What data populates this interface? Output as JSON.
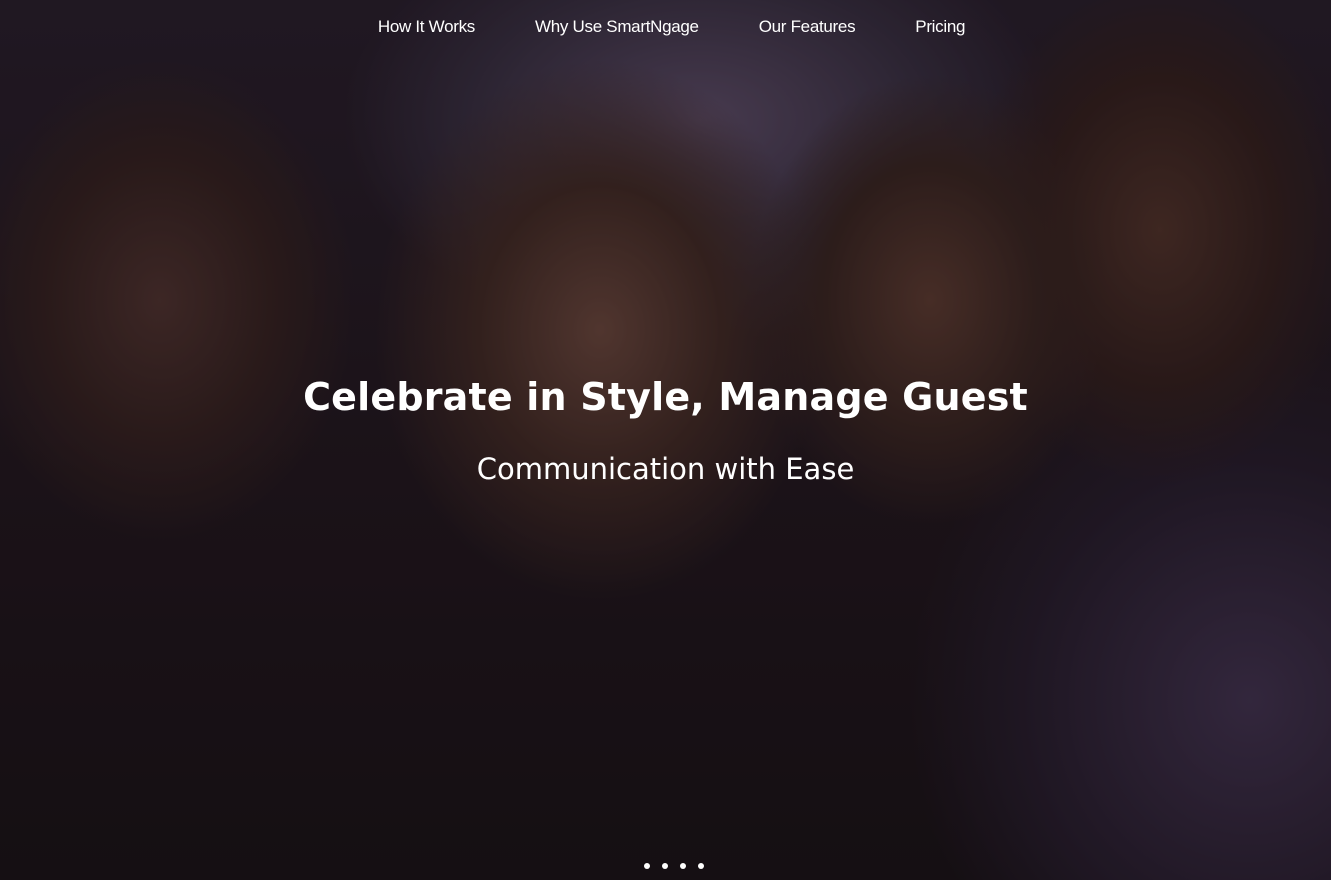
{
  "nav": {
    "items": [
      {
        "label": "How It Works"
      },
      {
        "label": "Why Use SmartNgage"
      },
      {
        "label": "Our Features"
      },
      {
        "label": "Pricing"
      }
    ]
  },
  "hero": {
    "headline": "Celebrate in Style, Manage Guest",
    "subheadline": "Communication with Ease",
    "background_image": "group-of-friends-celebrating-photo",
    "overlay_color": "#0c080e"
  },
  "carousel": {
    "slide_count": 4,
    "dot_color": "#ffffff"
  }
}
